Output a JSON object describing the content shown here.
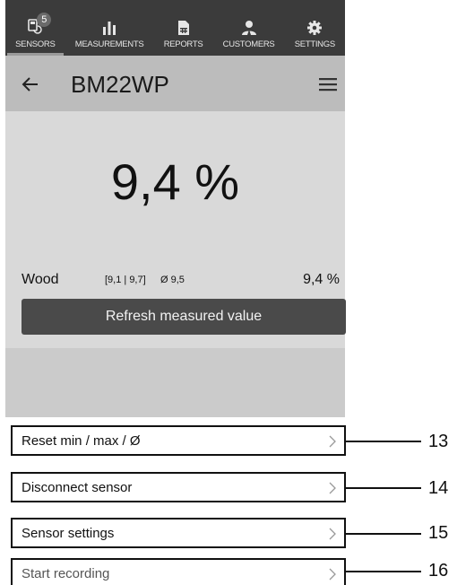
{
  "nav": {
    "badge_count": "5",
    "items": [
      {
        "label": "SENSORS",
        "icon": "sensor-icon"
      },
      {
        "label": "MEASUREMENTS",
        "icon": "bar-chart-icon"
      },
      {
        "label": "REPORTS",
        "icon": "report-icon"
      },
      {
        "label": "CUSTOMERS",
        "icon": "customers-icon"
      },
      {
        "label": "SETTINGS",
        "icon": "gear-icon"
      }
    ],
    "active": "SENSORS"
  },
  "header": {
    "title": "BM22WP",
    "back_icon": "arrow-left-icon",
    "menu_icon": "hamburger-menu-icon"
  },
  "reading": {
    "value": "9,4 %"
  },
  "material": {
    "label": "Wood",
    "range": "[9,1 | 9,7]",
    "average": "Ø 9,5",
    "value": "9,4 %"
  },
  "refresh_button": "Refresh measured value",
  "actions": [
    {
      "label": "Reset min / max / Ø",
      "callout": "13"
    },
    {
      "label": "Disconnect sensor",
      "callout": "14"
    },
    {
      "label": "Sensor settings",
      "callout": "15"
    },
    {
      "label": "Start recording",
      "callout": "16"
    }
  ],
  "colors": {
    "nav_background": "#3b3b3b",
    "header_background": "#bcbcbc",
    "content_background": "#d9d9d9",
    "button_background": "#4a4a4a"
  }
}
